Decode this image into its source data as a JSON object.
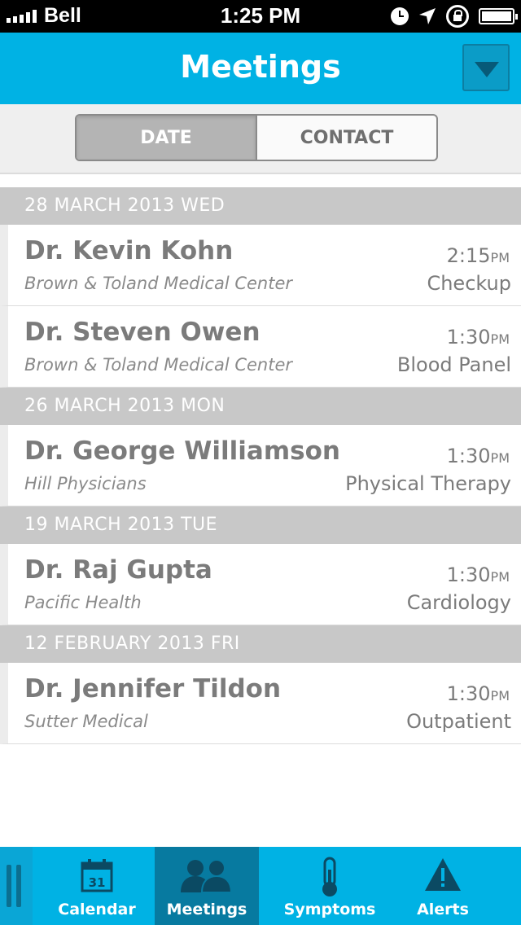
{
  "status_bar": {
    "carrier": "Bell",
    "time": "1:25 PM"
  },
  "nav": {
    "title": "Meetings"
  },
  "segments": [
    {
      "label": "DATE",
      "active": true
    },
    {
      "label": "CONTACT",
      "active": false
    }
  ],
  "sections": [
    {
      "header": "28 MARCH 2013  WED",
      "items": [
        {
          "name": "Dr. Kevin Kohn",
          "place": "Brown & Toland Medical Center",
          "time": "2:15",
          "ampm": "PM",
          "type": "Checkup"
        },
        {
          "name": "Dr. Steven Owen",
          "place": "Brown & Toland Medical Center",
          "time": "1:30",
          "ampm": "PM",
          "type": "Blood Panel"
        }
      ]
    },
    {
      "header": "26 MARCH 2013  MON",
      "items": [
        {
          "name": "Dr. George Williamson",
          "place": "Hill Physicians",
          "time": "1:30",
          "ampm": "PM",
          "type": "Physical Therapy"
        }
      ]
    },
    {
      "header": "19 MARCH 2013  TUE",
      "items": [
        {
          "name": "Dr. Raj Gupta",
          "place": "Pacific Health",
          "time": "1:30",
          "ampm": "PM",
          "type": "Cardiology"
        }
      ]
    },
    {
      "header": "12 FEBRUARY 2013  FRI",
      "items": [
        {
          "name": "Dr. Jennifer Tildon",
          "place": "Sutter Medical",
          "time": "1:30",
          "ampm": "PM",
          "type": "Outpatient"
        }
      ]
    }
  ],
  "tabs": [
    {
      "label": "Calendar",
      "icon": "calendar-icon",
      "calendar_day": "31"
    },
    {
      "label": "Meetings",
      "icon": "people-icon",
      "active": true
    },
    {
      "label": "Symptoms",
      "icon": "thermometer-icon"
    },
    {
      "label": "Alerts",
      "icon": "warning-icon"
    }
  ],
  "colors": {
    "accent": "#00b2e4",
    "accent_dark": "#077aa0",
    "section_header": "#c8c8c8"
  }
}
